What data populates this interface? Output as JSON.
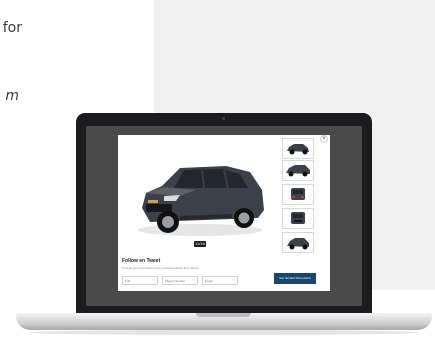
{
  "side_text": {
    "top": "for",
    "middle": "m"
  },
  "gallery": {
    "image_counter": "11/16",
    "close_icon": "×",
    "thumbnail_count_visible": 5
  },
  "form": {
    "title": "Follow en Tweet",
    "subtitle": "Provide your info below to be contacted about this vehicle",
    "fields": [
      {
        "placeholder": "Full"
      },
      {
        "placeholder": "Phone Number"
      },
      {
        "placeholder": "Email"
      }
    ],
    "submit_label": "Get Verified Price Alerts"
  },
  "colors": {
    "submit_bg": "#18466f",
    "car_body": "#3c4048",
    "laptop_bezel": "#1c1c1e",
    "background_panel": "#f1f1f2"
  }
}
